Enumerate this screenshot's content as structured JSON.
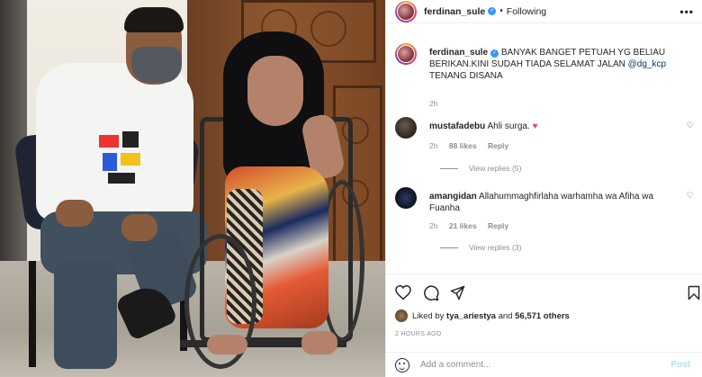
{
  "post": {
    "username": "ferdinan_sule",
    "follow_status": "Following",
    "more_label": "•••",
    "caption_username": "ferdinan_sule",
    "caption_text_1": "BANYAK BANGET PETUAH YG BELIAU BERIKAN.KINI SUDAH TIADA SELAMAT JALAN ",
    "caption_mention": "@dg_kcp",
    "caption_text_2": " TENANG DISANA",
    "caption_time": "2h"
  },
  "comments": [
    {
      "username": "mustafadebu",
      "text": "Ahli surga. ",
      "emoji": "♥",
      "time": "2h",
      "likes": "88 likes",
      "reply_label": "Reply",
      "view_replies": "View replies (5)"
    },
    {
      "username": "amangidan",
      "text": "Allahummaghfirlaha warhamha wa Afiha wa Fuanha",
      "time": "2h",
      "likes": "21 likes",
      "reply_label": "Reply",
      "view_replies": "View replies (3)"
    }
  ],
  "likes_bar": {
    "prefix": "Liked by ",
    "user": "tya_ariestya",
    "middle": " and ",
    "count": "56,571 others"
  },
  "timestamp": "2 HOURS AGO",
  "comment_input": {
    "placeholder": "Add a comment...",
    "post_label": "Post"
  },
  "colors": {
    "verified": "#3897f0",
    "mention": "#00376b",
    "heart": "#ed4956",
    "post_disabled": "#b2dffc"
  }
}
